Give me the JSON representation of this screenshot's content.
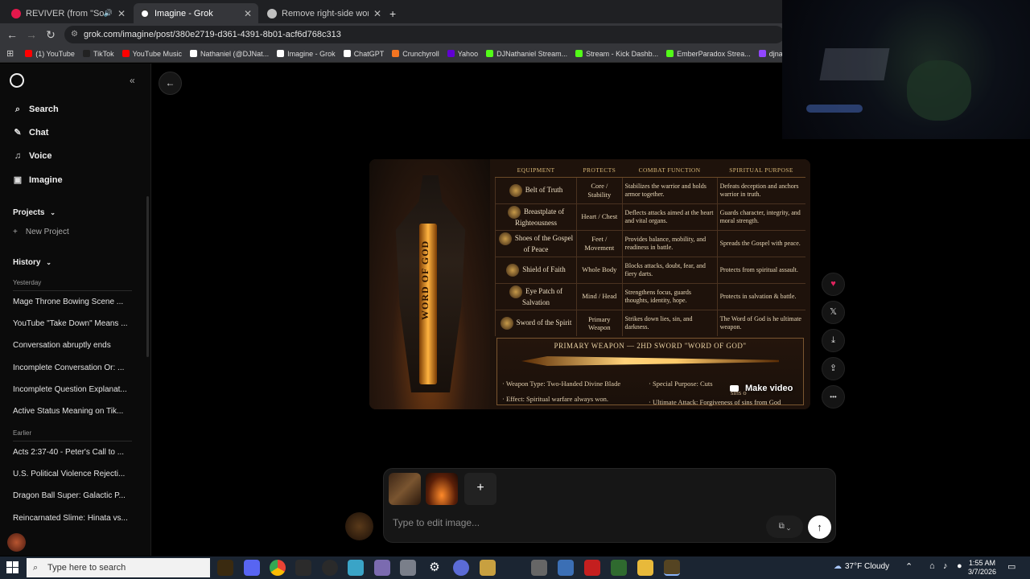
{
  "browser": {
    "tabs": [
      {
        "label": "REVIVER (from \"Solo Leveli",
        "active": false,
        "color": "#e5184c",
        "audio": true
      },
      {
        "label": "Imagine - Grok",
        "active": true,
        "color": "#ffffff"
      },
      {
        "label": "Remove right-side words",
        "active": false,
        "color": "#c0c0c0"
      }
    ],
    "new_tab": "+",
    "url": "grok.com/imagine/post/380e2719-d361-4391-8b01-acf6d768c313",
    "bookmarks": [
      {
        "label": "(1) YouTube",
        "color": "#ff0000"
      },
      {
        "label": "TikTok",
        "color": "#222222"
      },
      {
        "label": "YouTube Music",
        "color": "#ff0000"
      },
      {
        "label": "Nathaniel (@DJNat...",
        "color": "#ffffff"
      },
      {
        "label": "Imagine - Grok",
        "color": "#ffffff"
      },
      {
        "label": "ChatGPT",
        "color": "#ffffff"
      },
      {
        "label": "Crunchyroll",
        "color": "#f47521"
      },
      {
        "label": "Yahoo",
        "color": "#6001d2"
      },
      {
        "label": "DJNathaniel Stream...",
        "color": "#53fc18"
      },
      {
        "label": "Stream - Kick Dashb...",
        "color": "#53fc18"
      },
      {
        "label": "EmberParadox Strea...",
        "color": "#53fc18"
      },
      {
        "label": "djnathanielrs3 - Tw",
        "color": "#9146ff"
      }
    ]
  },
  "sidebar": {
    "nav": [
      {
        "label": "Search",
        "icon": "search-icon"
      },
      {
        "label": "Chat",
        "icon": "chat-icon"
      },
      {
        "label": "Voice",
        "icon": "voice-icon"
      },
      {
        "label": "Imagine",
        "icon": "imagine-icon"
      }
    ],
    "projects_label": "Projects",
    "new_project": "New Project",
    "history_label": "History",
    "yesterday_label": "Yesterday",
    "yesterday": [
      "Mage Throne Bowing Scene ...",
      "YouTube \"Take Down\" Means ...",
      "Conversation abruptly ends",
      "Incomplete Conversation Or: ...",
      "Incomplete Question Explanat...",
      "Active Status Meaning on Tik..."
    ],
    "earlier_label": "Earlier",
    "earlier": [
      "Acts 2:37-40 - Peter's Call to ...",
      "U.S. Political Violence Rejecti...",
      "Dragon Ball Super: Galactic P...",
      "Reincarnated Slime: Hinata vs..."
    ]
  },
  "image": {
    "sword_text": "WORD OF GOD",
    "headers": [
      "EQUIPMENT",
      "PROTECTS",
      "COMBAT FUNCTION",
      "SPIRITUAL PURPOSE"
    ],
    "rows": [
      [
        "Belt of Truth",
        "Core / Stability",
        "Stabilizes the warrior and holds armor together.",
        "Defeats deception and anchors warrior in truth."
      ],
      [
        "Breastplate of Righteousness",
        "Heart / Chest",
        "Deflects attacks aimed at the heart and vital organs.",
        "Guards character, integrity, and moral strength."
      ],
      [
        "Shoes of the Gospel of Peace",
        "Feet / Movement",
        "Provides balance, mobility, and readiness in battle.",
        "Spreads the Gospel with peace."
      ],
      [
        "Shield of Faith",
        "Whole Body",
        "Blocks attacks, doubt, fear, and fiery darts.",
        "Protects from spiritual assault."
      ],
      [
        "Eye Patch of Salvation",
        "Mind / Head",
        "Strengthens focus, guards thoughts, identity, hope.",
        "Protects in salvation & battle."
      ],
      [
        "Sword of the Spirit",
        "Primary Weapon",
        "Strikes down lies, sin, and darkness.",
        "The Word of God is he ultimate weapon."
      ]
    ],
    "primary_title": "PRIMARY WEAPON — 2HD SWORD \"WORD OF GOD\"",
    "weapon_type": "Weapon Type: Two-Handed Divine Blade",
    "special_purpose": "Special Purpose: Cuts",
    "special_purpose_2": "sins o",
    "effect": "Effect: Spiritual warfare always won.",
    "ultimate": "Ultimate Attack: Forgiveness of sins from God"
  },
  "make_video": "Make video",
  "actions": [
    {
      "icon": "heart-icon",
      "glyph": "♥"
    },
    {
      "icon": "x-share-icon",
      "glyph": "𝕏"
    },
    {
      "icon": "download-icon",
      "glyph": "⤓"
    },
    {
      "icon": "share-icon",
      "glyph": "⇪"
    },
    {
      "icon": "more-icon",
      "glyph": "•••"
    }
  ],
  "composer": {
    "placeholder": "Type to edit image...",
    "add": "+",
    "send": "↑"
  },
  "taskbar": {
    "search_placeholder": "Type here to search",
    "weather": "37°F  Cloudy",
    "time": "1:55 AM",
    "date": "3/7/2026"
  }
}
